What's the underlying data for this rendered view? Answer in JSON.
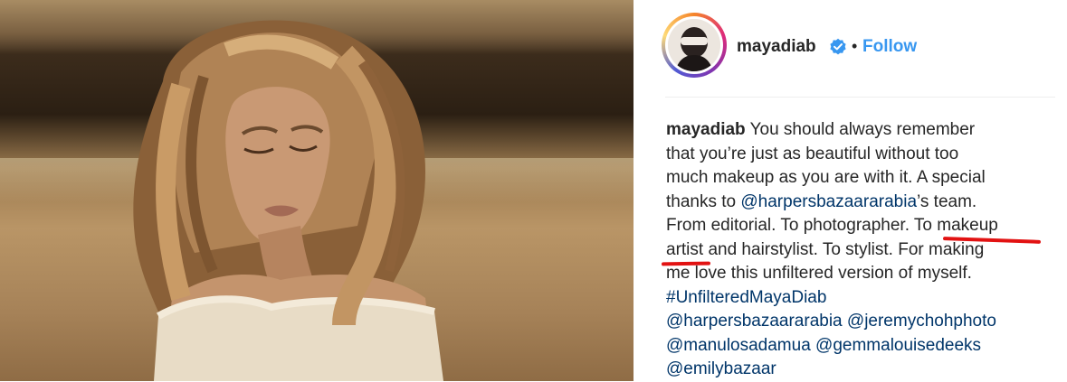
{
  "post": {
    "username": "mayadiab",
    "follow_label": "Follow",
    "separator": "•",
    "icons": {
      "verified": "verified-badge-icon"
    },
    "colors": {
      "follow": "#3897f0",
      "link": "#003569",
      "annotation": "#e21212"
    }
  },
  "caption": {
    "author": "mayadiab",
    "line1_text": " You should always remember",
    "line2": "that you’re just as beautiful without too",
    "line3": "much makeup as you are with it. A special",
    "line4_pre": "thanks to ",
    "line4_mention": "@harpersbazaararabia",
    "line4_post": "’s team.",
    "line5": "From editorial. To photographer. To makeup",
    "line6": "artist and hairstylist. To stylist. For making",
    "line7": "me love this unfiltered version of myself.",
    "hashtag": "#UnfilteredMayaDiab",
    "mention1": "@harpersbazaararabia",
    "mention2": "@jeremychohphoto",
    "mention3": "@manulosadamua",
    "mention4": "@gemmalouisedeeks",
    "mention5": "@emilybazaar"
  }
}
